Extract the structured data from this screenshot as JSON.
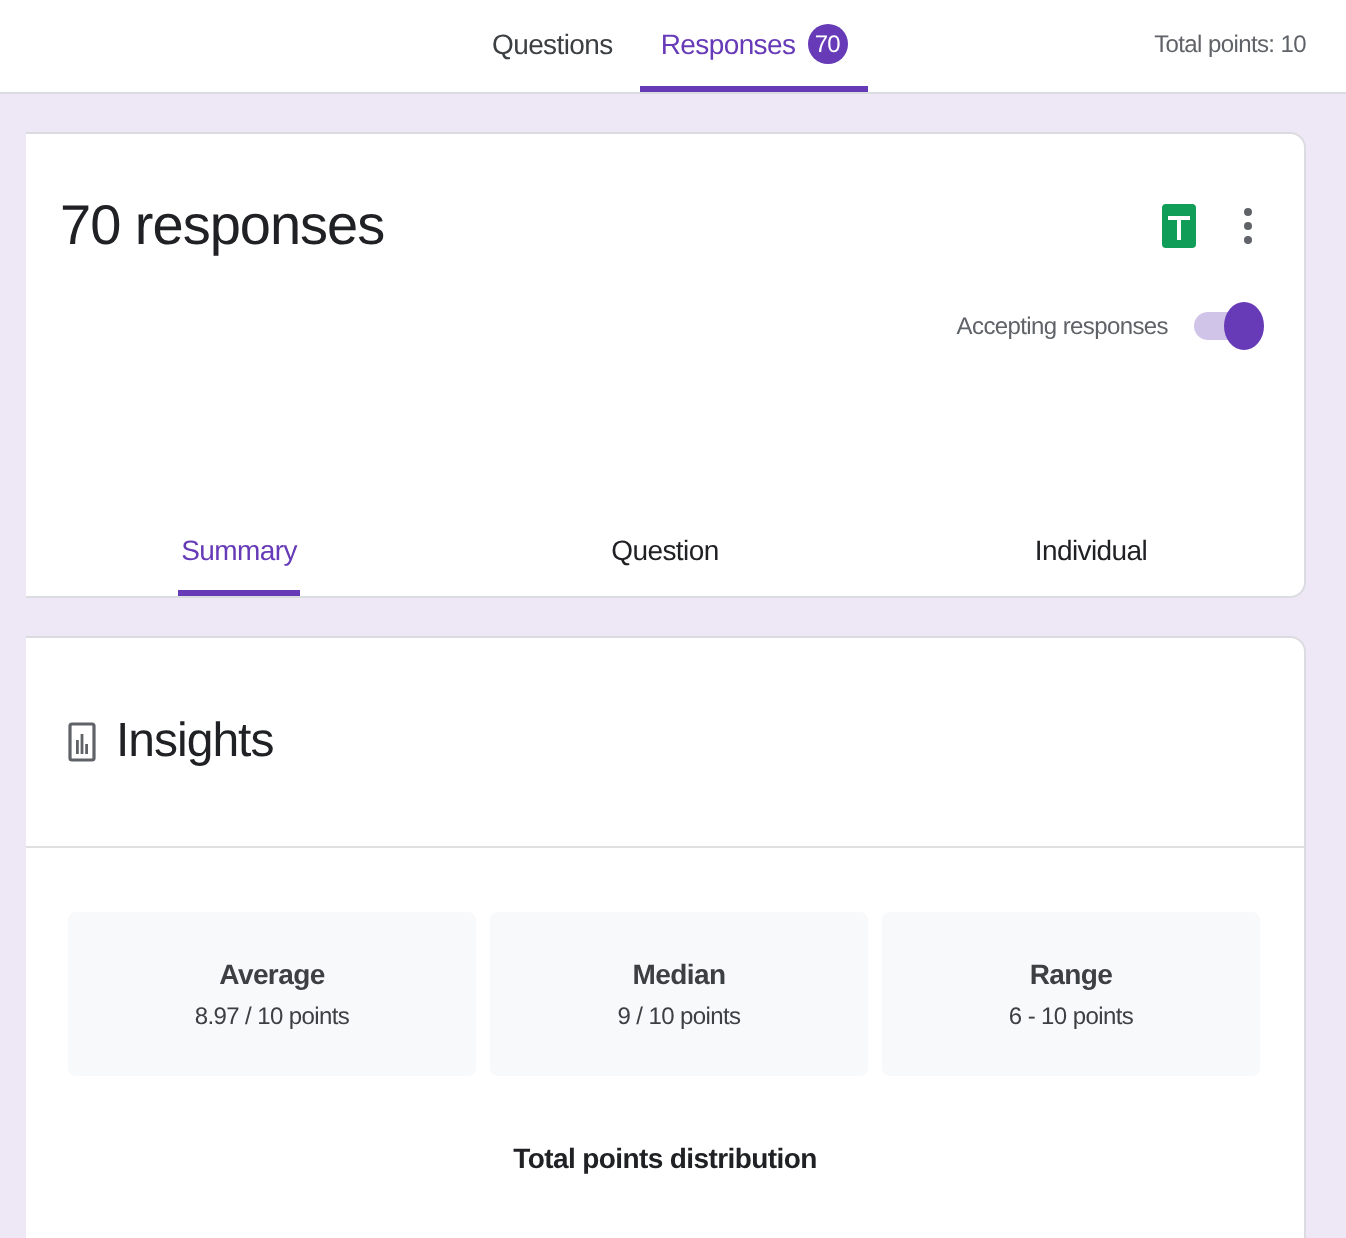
{
  "top_tabs": [
    {
      "label": "Questions",
      "selected": false
    },
    {
      "label": "Responses",
      "selected": true,
      "badge": "70"
    }
  ],
  "total_points": "Total points: 10",
  "summary_card": {
    "title": "70 responses",
    "accepting": {
      "label": "Accepting responses",
      "on": true
    },
    "view_tabs": [
      {
        "label": "Summary",
        "selected": true
      },
      {
        "label": "Question",
        "selected": false
      },
      {
        "label": "Individual",
        "selected": false
      }
    ]
  },
  "insights": {
    "title": "Insights",
    "stats": [
      {
        "label": "Average",
        "value": "8.97 / 10 points"
      },
      {
        "label": "Median",
        "value": "9 / 10 points"
      },
      {
        "label": "Range",
        "value": "6 - 10 points"
      }
    ],
    "distribution_title": "Total points distribution"
  }
}
